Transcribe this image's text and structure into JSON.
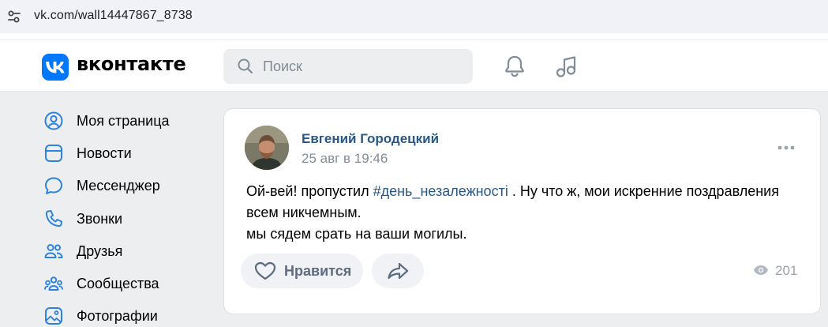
{
  "browser": {
    "url": "vk.com/wall14447867_8738"
  },
  "header": {
    "logo_text": "вконтакте",
    "search_placeholder": "Поиск"
  },
  "sidebar": {
    "items": [
      {
        "label": "Моя страница",
        "icon": "profile-icon"
      },
      {
        "label": "Новости",
        "icon": "news-icon"
      },
      {
        "label": "Мессенджер",
        "icon": "messenger-icon"
      },
      {
        "label": "Звонки",
        "icon": "phone-icon"
      },
      {
        "label": "Друзья",
        "icon": "friends-icon"
      },
      {
        "label": "Сообщества",
        "icon": "communities-icon"
      },
      {
        "label": "Фотографии",
        "icon": "photos-icon"
      }
    ]
  },
  "post": {
    "author": "Евгений Городецкий",
    "date": "25 авг в 19:46",
    "text_before_tag": "Ой-вей! пропустил ",
    "hashtag": "#день_незалежності",
    "text_after_tag": " . Ну что ж, мои искренние поздравления всем никчемным.",
    "text_line_3": "мы сядем срать на ваши могилы.",
    "like_label": "Нравится",
    "views": "201"
  },
  "colors": {
    "brand": "#0077ff",
    "link": "#2a5885",
    "muted": "#818c99",
    "page_bg": "#edeef0"
  }
}
